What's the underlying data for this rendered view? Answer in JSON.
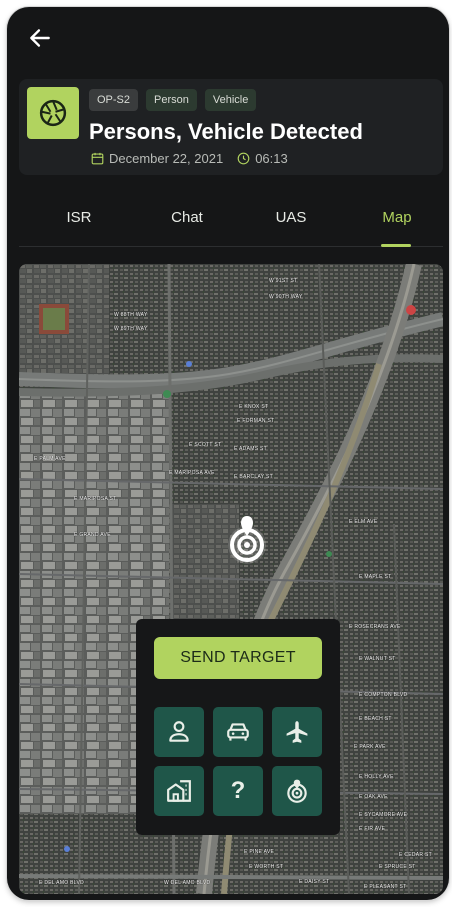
{
  "header": {
    "back_icon": "arrow-left-icon"
  },
  "alert": {
    "icon": "camera-shutter-icon",
    "tags": [
      "OP-S2",
      "Person",
      "Vehicle"
    ],
    "title": "Persons, Vehicle Detected",
    "date": "December 22, 2021",
    "time": "06:13",
    "accent_color": "#b1d35f"
  },
  "tabs": [
    {
      "label": "ISR",
      "active": false
    },
    {
      "label": "Chat",
      "active": false
    },
    {
      "label": "UAS",
      "active": false
    },
    {
      "label": "Map",
      "active": true
    }
  ],
  "map": {
    "streets": [
      "W 88TH WAY",
      "W 89TH WAY",
      "W 90TH WAY",
      "W 91ST ST",
      "E KNOX ST",
      "E FORMAN ST",
      "E ADAMS ST",
      "E BARCLAY ST",
      "E SCOTT ST",
      "E MARIPOSA AVE",
      "E PALM AVE",
      "E MARIPOSA ST",
      "E GRAND AVE",
      "E ELM AVE",
      "E MAPLE ST",
      "E ROSECRANS AVE",
      "E WALNUT ST",
      "E COMPTON BLVD",
      "E BEACH ST",
      "E PARK AVE",
      "E HOLLY AVE",
      "E OAK AVE",
      "E SYCAMORE AVE",
      "E FIR AVE",
      "E PINE AVE",
      "E WORTH ST",
      "E CEDAR ST",
      "E SPRUCE ST",
      "E DAISY ST",
      "E PLEASANT ST",
      "E DEL AMO BLVD",
      "W DEL AMO BLVD"
    ],
    "marker_icon": "target-pin-icon"
  },
  "panel": {
    "send_label": "SEND TARGET",
    "target_types": [
      {
        "icon": "person-icon"
      },
      {
        "icon": "car-icon"
      },
      {
        "icon": "airplane-icon"
      },
      {
        "icon": "building-icon"
      },
      {
        "icon": "question-icon",
        "label": "?"
      },
      {
        "icon": "target-icon"
      }
    ]
  }
}
